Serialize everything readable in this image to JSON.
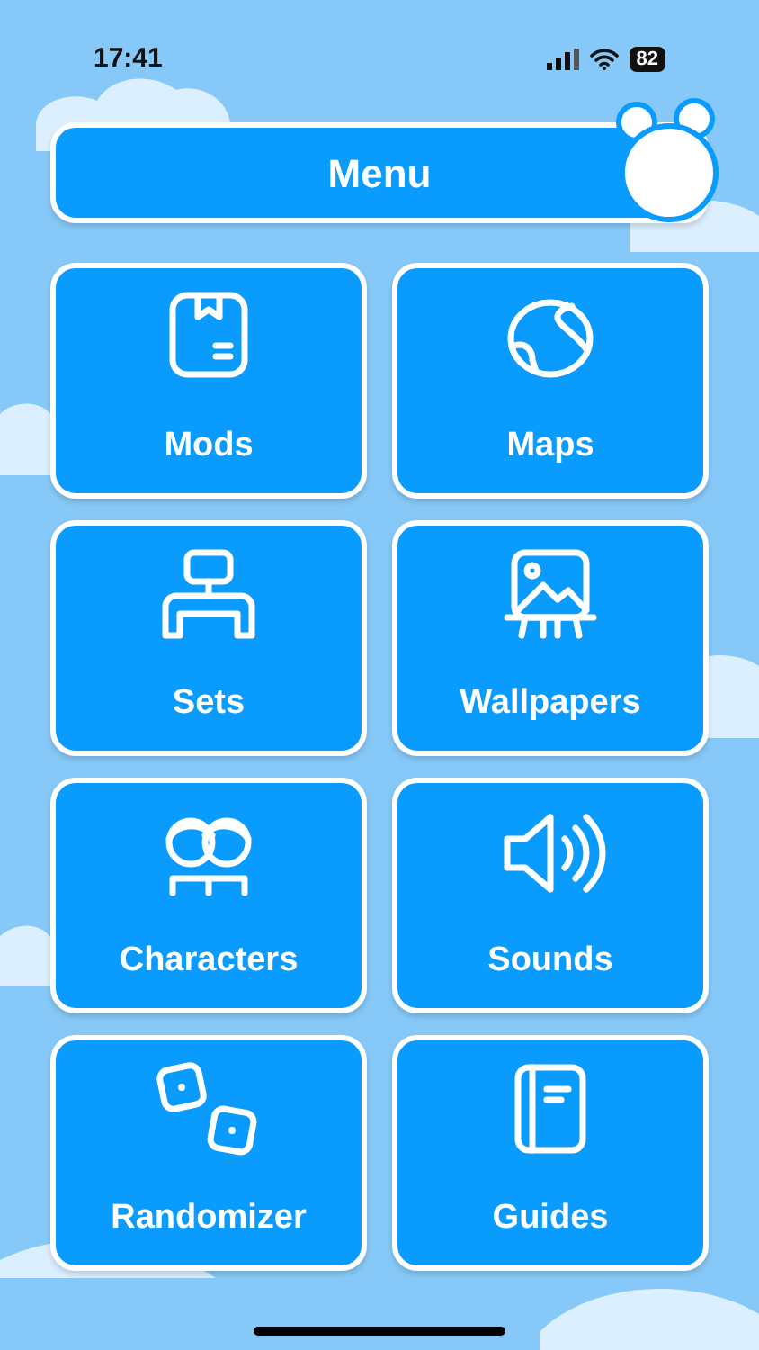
{
  "status_bar": {
    "time": "17:41",
    "battery": "82"
  },
  "header": {
    "title": "Menu"
  },
  "menu_items": [
    {
      "label": "Mods"
    },
    {
      "label": "Maps"
    },
    {
      "label": "Sets"
    },
    {
      "label": "Wallpapers"
    },
    {
      "label": "Characters"
    },
    {
      "label": "Sounds"
    },
    {
      "label": "Randomizer"
    },
    {
      "label": "Guides"
    }
  ]
}
